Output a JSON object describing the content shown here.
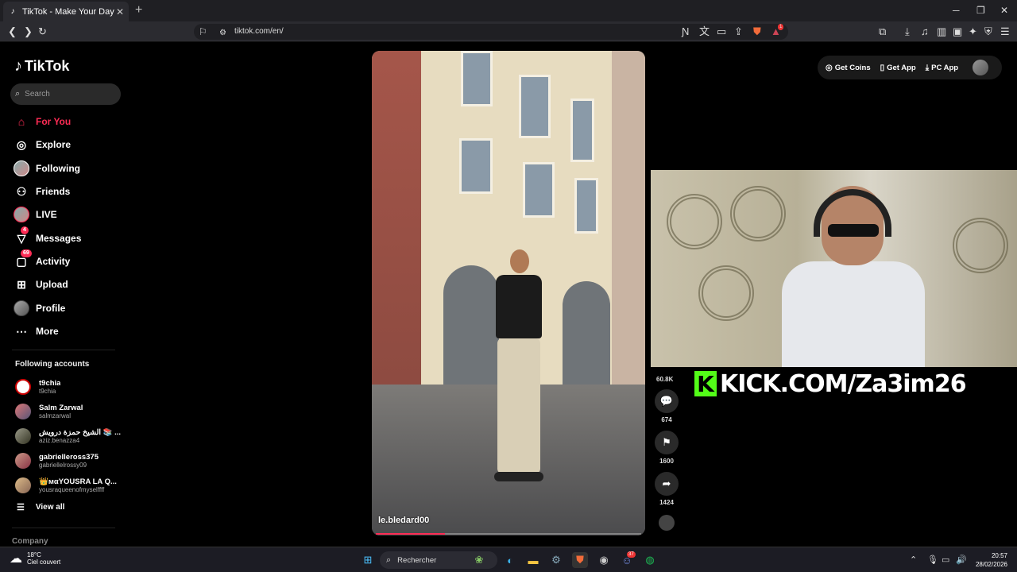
{
  "browser": {
    "tab_title": "TikTok - Make Your Day",
    "url": "tiktok.com/en/",
    "ext_badge": "1"
  },
  "sidebar": {
    "logo_text": "TikTok",
    "search_placeholder": "Search",
    "nav": [
      {
        "label": "For You",
        "icon": "home-icon",
        "active": true
      },
      {
        "label": "Explore",
        "icon": "compass-icon"
      },
      {
        "label": "Following",
        "icon": "avatar-icon"
      },
      {
        "label": "Friends",
        "icon": "friends-icon"
      },
      {
        "label": "LIVE",
        "icon": "live-icon"
      },
      {
        "label": "Messages",
        "icon": "send-icon",
        "badge": "4"
      },
      {
        "label": "Activity",
        "icon": "inbox-icon",
        "badge": "69"
      },
      {
        "label": "Upload",
        "icon": "plus-square-icon"
      },
      {
        "label": "Profile",
        "icon": "profile-avatar-icon"
      },
      {
        "label": "More",
        "icon": "ellipsis-icon"
      }
    ],
    "following_title": "Following accounts",
    "accounts": [
      {
        "name": "t9chia",
        "handle": "t9chia"
      },
      {
        "name": "Salm Zarwal",
        "handle": "salmzarwal"
      },
      {
        "name": "الشيخ حمزة درويش 📚 ...",
        "handle": "aziz.benazza4"
      },
      {
        "name": "gabrielleross375",
        "handle": "gabriellelrossy09"
      },
      {
        "name": "👑мαYOUSRA LA Q...",
        "handle": "yousraqueenofmyselffff"
      }
    ],
    "view_all": "View all",
    "company": "Company"
  },
  "topbar": {
    "coins": "Get Coins",
    "app": "Get App",
    "pc_app": "PC App"
  },
  "video": {
    "username": "le.bledard00",
    "progress": 0.26
  },
  "actions": {
    "likes": "60.8K",
    "comments": "674",
    "saves": "1600",
    "shares": "1424"
  },
  "overlay": {
    "kick_text": "KICK.COM/Za3im26"
  },
  "taskbar": {
    "temp": "18°C",
    "weather": "Ciel couvert",
    "search": "Rechercher",
    "time": "20:57",
    "date": "28/02/2026",
    "discord_badge": "37"
  }
}
